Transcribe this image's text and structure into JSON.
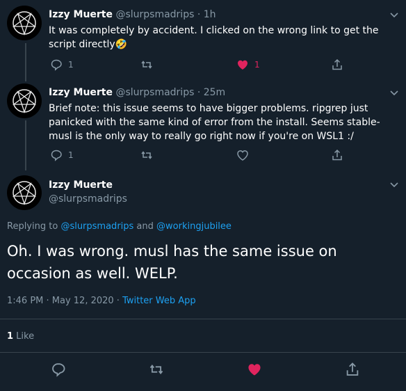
{
  "tweets": [
    {
      "name": "Izzy Muerte",
      "handle": "@slurpsmadrips",
      "time": "· 1h",
      "text": "It was completely by accident. I clicked on the wrong link to get the script directly🤣",
      "reply_count": "1",
      "retweet_count": "",
      "like_count": "1",
      "liked": true
    },
    {
      "name": "Izzy Muerte",
      "handle": "@slurpsmadrips",
      "time": "· 25m",
      "text": "Brief note: this issue seems to have bigger problems. ripgrep just panicked with the same kind of error from the install. Seems stable-musl is the only way to really go right now if you're on WSL1 :/",
      "reply_count": "1",
      "retweet_count": "",
      "like_count": "",
      "liked": false
    }
  ],
  "main": {
    "name": "Izzy Muerte",
    "handle": "@slurpsmadrips",
    "replying_prefix": "Replying to ",
    "reply_user_1": "@slurpsmadrips",
    "replying_and": " and ",
    "reply_user_2": "@workingjubilee",
    "text": "Oh. I was wrong. musl has the same issue on occasion as well. WELP.",
    "timestamp": "1:46 PM · May 12, 2020 · ",
    "app": "Twitter Web App",
    "like_count": "1",
    "like_label": " Like"
  },
  "colors": {
    "background": "#15202b",
    "accent": "#1da1f2",
    "like": "#e0245e",
    "muted": "#8899a6"
  },
  "icons": [
    "pentagram-avatar-icon",
    "chevron-down-icon",
    "reply-icon",
    "retweet-icon",
    "heart-icon",
    "share-icon"
  ]
}
